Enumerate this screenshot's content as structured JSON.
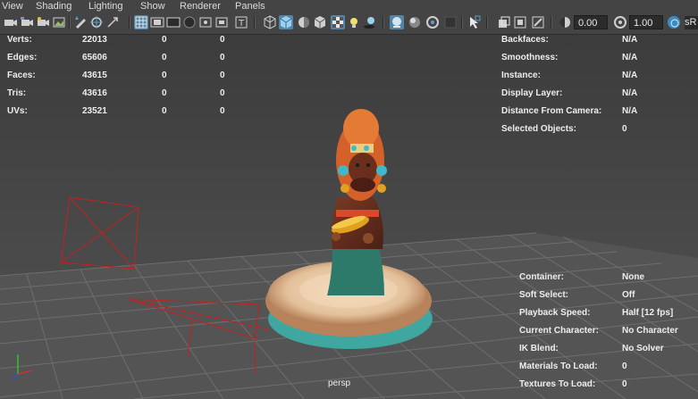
{
  "menu": [
    "View",
    "Shading",
    "Lighting",
    "Show",
    "Renderer",
    "Panels"
  ],
  "toolbar": {
    "icons": [
      "camera-select-icon",
      "camera-attributes-icon",
      "bookmark-icon",
      "image-plane-icon",
      "grease-pencil-icon",
      "grid-icon",
      "film-gate-icon",
      "resolution-gate-icon",
      "gate-mask-icon",
      "field-chart-icon",
      "safe-action-icon",
      "safe-title-icon",
      "wireframe-icon",
      "smooth-shade-icon",
      "flat-shade-icon",
      "shade-selected-icon",
      "wireframe-on-shaded-icon",
      "textured-icon",
      "lights-icon",
      "shadows-icon",
      "xray-icon",
      "xray-active-icon",
      "xray-joints-icon",
      "backface-icon",
      "isolate-select-icon",
      "ao-icon",
      "motion-blur-icon",
      "anti-alias-icon",
      "depth-of-field-icon",
      "exposure-icon",
      "gamma-icon"
    ],
    "exposure_value": "0.00",
    "gamma_value": "1.00",
    "color_space_label": "sR"
  },
  "hud_left": {
    "rows": [
      {
        "label": "Verts:",
        "c1": "22013",
        "c2": "0",
        "c3": "0"
      },
      {
        "label": "Edges:",
        "c1": "65606",
        "c2": "0",
        "c3": "0"
      },
      {
        "label": "Faces:",
        "c1": "43615",
        "c2": "0",
        "c3": "0"
      },
      {
        "label": "Tris:",
        "c1": "43616",
        "c2": "0",
        "c3": "0"
      },
      {
        "label": "UVs:",
        "c1": "23521",
        "c2": "0",
        "c3": "0"
      }
    ]
  },
  "hud_right_top": {
    "rows": [
      {
        "label": "Backfaces:",
        "value": "N/A"
      },
      {
        "label": "Smoothness:",
        "value": "N/A"
      },
      {
        "label": "Instance:",
        "value": "N/A"
      },
      {
        "label": "Display Layer:",
        "value": "N/A"
      },
      {
        "label": "Distance From Camera:",
        "value": "N/A"
      },
      {
        "label": "Selected Objects:",
        "value": "0"
      }
    ]
  },
  "hud_right_bottom": {
    "rows": [
      {
        "label": "Container:",
        "value": "None"
      },
      {
        "label": "Soft Select:",
        "value": "Off"
      },
      {
        "label": "Playback Speed:",
        "value": "Half  [12 fps]"
      },
      {
        "label": "Current Character:",
        "value": "No Character"
      },
      {
        "label": "IK Blend:",
        "value": "No Solver"
      },
      {
        "label": "Materials To Load:",
        "value": "0"
      },
      {
        "label": "Textures To Load:",
        "value": "0"
      }
    ]
  },
  "camera_name": "persp",
  "colors": {
    "background": "#444444",
    "grid": "#6a6a6a",
    "camera_wire": "#c42020",
    "active_toggle": "#5285a6"
  }
}
